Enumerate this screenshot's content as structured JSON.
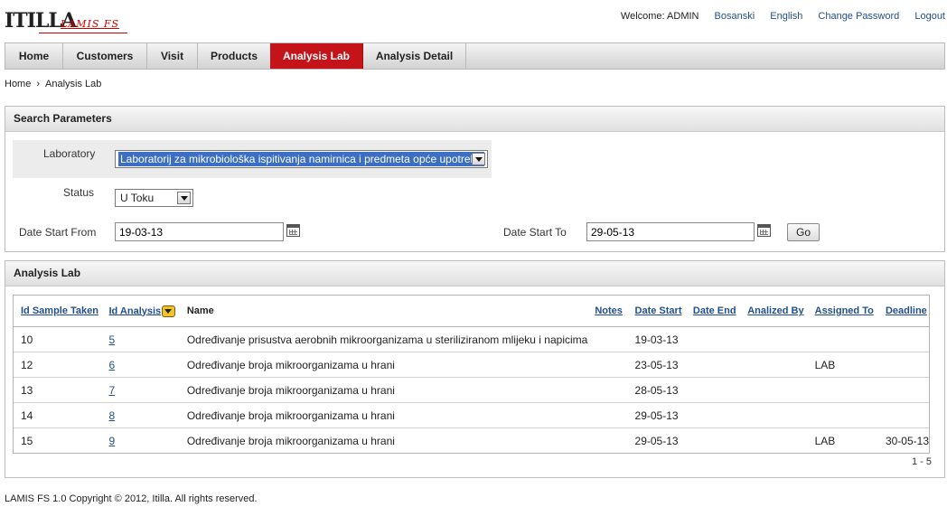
{
  "header": {
    "logo_brand": "ITILLA",
    "logo_sub": "LAMIS FS",
    "welcome": "Welcome: ADMIN",
    "links": [
      "Bosanski",
      "English",
      "Change Password",
      "Logout"
    ]
  },
  "tabs": [
    "Home",
    "Customers",
    "Visit",
    "Products",
    "Analysis Lab",
    "Analysis Detail"
  ],
  "active_tab": "Analysis Lab",
  "breadcrumb": {
    "home": "Home",
    "current": "Analysis Lab"
  },
  "search": {
    "title": "Search Parameters",
    "laboratory_label": "Laboratory",
    "laboratory_value": "Laboratorij za mikrobiološka ispitivanja namirnica i predmeta opće upotrebe",
    "status_label": "Status",
    "status_value": "U Toku",
    "date_from_label": "Date Start From",
    "date_from_value": "19-03-13",
    "date_to_label": "Date Start To",
    "date_to_value": "29-05-13",
    "go_label": "Go"
  },
  "results": {
    "title": "Analysis Lab",
    "columns": [
      "Id Sample Taken",
      "Id Analysis",
      "Name",
      "Notes",
      "Date Start",
      "Date End",
      "Analized By",
      "Assigned To",
      "Deadline"
    ],
    "rows": [
      {
        "id_sample": "10",
        "id_analysis": "5",
        "name": "Određivanje prisustva aerobnih mikroorganizama u steriliziranom mlijeku i napicima",
        "notes": "",
        "date_start": "19-03-13",
        "date_end": "",
        "analized_by": "",
        "assigned_to": "",
        "deadline": ""
      },
      {
        "id_sample": "12",
        "id_analysis": "6",
        "name": "Određivanje broja mikroorganizama u hrani",
        "notes": "",
        "date_start": "23-05-13",
        "date_end": "",
        "analized_by": "",
        "assigned_to": "LAB",
        "deadline": ""
      },
      {
        "id_sample": "13",
        "id_analysis": "7",
        "name": "Određivanje broja mikroorganizama u hrani",
        "notes": "",
        "date_start": "28-05-13",
        "date_end": "",
        "analized_by": "",
        "assigned_to": "",
        "deadline": ""
      },
      {
        "id_sample": "14",
        "id_analysis": "8",
        "name": "Određivanje broja mikroorganizama u hrani",
        "notes": "",
        "date_start": "29-05-13",
        "date_end": "",
        "analized_by": "",
        "assigned_to": "",
        "deadline": ""
      },
      {
        "id_sample": "15",
        "id_analysis": "9",
        "name": "Određivanje broja mikroorganizama u hrani",
        "notes": "",
        "date_start": "29-05-13",
        "date_end": "",
        "analized_by": "",
        "assigned_to": "LAB",
        "deadline": "30-05-13"
      }
    ],
    "pager": "1 - 5"
  },
  "footer": "LAMIS FS 1.0 Copyright © 2012, Itilla. All rights reserved.",
  "colors": {
    "accent": "#c5131a",
    "link": "#1f4f8c"
  }
}
